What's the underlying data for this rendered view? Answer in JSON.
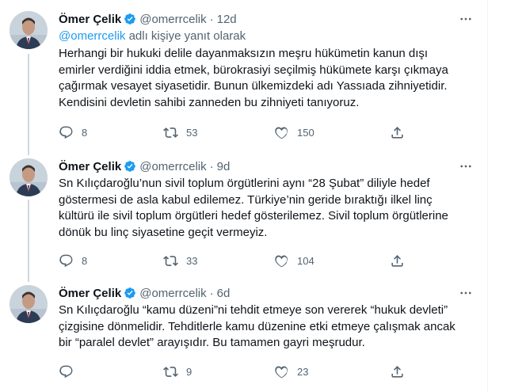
{
  "tweets": [
    {
      "name": "Ömer Çelik",
      "handle": "@omerrcelik",
      "dot": "·",
      "time": "12d",
      "reply_handle": "@omerrcelik",
      "reply_suffix": " adlı kişiye yanıt olarak",
      "lines": [
        "Herhangi bir hukuki delile dayanmaksızın meşru hükümetin kanun dışı",
        "emirler verdiğini iddia etmek, bürokrasiyi seçilmiş hükümete karşı çıkmaya",
        "çağırmak vesayet siyasetidir. Bunun ülkemizdeki adı Yassıada zihniyetidir.",
        "Kendisini devletin sahibi zanneden bu zihniyeti tanıyoruz."
      ],
      "replies": "8",
      "retweets": "53",
      "likes": "150"
    },
    {
      "name": "Ömer Çelik",
      "handle": "@omerrcelik",
      "dot": "·",
      "time": "9d",
      "lines": [
        "Sn Kılıçdaroğlu’nun sivil toplum örgütlerini aynı “28 Şubat” diliyle hedef",
        "göstermesi de asla kabul edilemez. Türkiye’nin geride bıraktığı ilkel linç",
        "kültürü ile sivil toplum örgütleri hedef gösterilemez. Sivil toplum örgütlerine",
        "dönük bu linç siyasetine geçit vermeyiz."
      ],
      "replies": "8",
      "retweets": "33",
      "likes": "104"
    },
    {
      "name": "Ömer Çelik",
      "handle": "@omerrcelik",
      "dot": "·",
      "time": "6d",
      "lines": [
        "Sn Kılıçdaroğlu “kamu düzeni”ni tehdit etmeye son vererek “hukuk devleti”",
        "çizgisine dönmelidir. Tehditlerle kamu düzenine etki etmeye çalışmak ancak",
        "bir “paralel devlet” arayışıdır. Bu tamamen gayri meşrudur."
      ],
      "replies": "",
      "retweets": "9",
      "likes": "23"
    }
  ],
  "icons": [
    "verified-badge-icon",
    "more-icon",
    "reply-icon",
    "retweet-icon",
    "like-icon",
    "share-icon"
  ],
  "colors": {
    "accent": "#1d9bf0",
    "secondary_text": "#536471",
    "thread_line": "#cfd9de"
  }
}
